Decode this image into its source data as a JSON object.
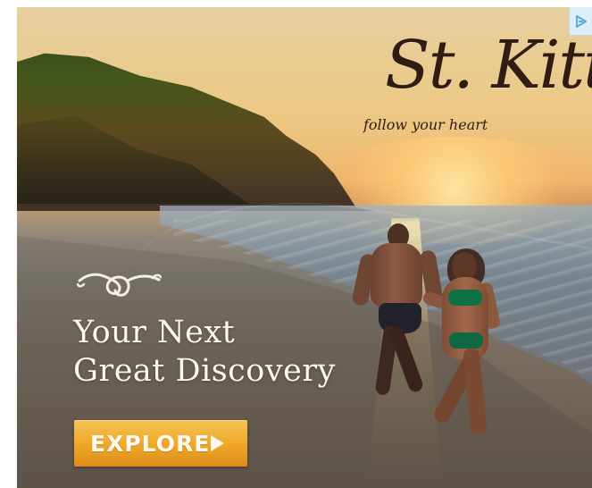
{
  "ad": {
    "brand": "St. Kitts",
    "tagline": "follow your heart",
    "headline_line_1": "Your Next",
    "headline_line_2": "Great Discovery",
    "cta_label": "EXPLORE"
  },
  "icons": {
    "ad_choice": "ad-choice-icon",
    "cta_arrow": "play-arrow-icon",
    "ornament": "heart-flourish-icon"
  },
  "colors": {
    "cta_top": "#f6c255",
    "cta_bottom": "#de8b18",
    "text_dark": "#2f1d14",
    "text_light": "#fff7ea",
    "badge_bg": "#dceef7"
  }
}
